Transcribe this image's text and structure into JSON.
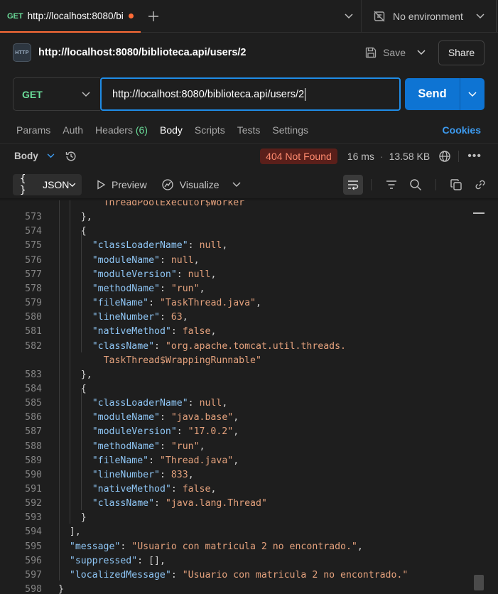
{
  "tab": {
    "method": "GET",
    "title": "http://localhost:8080/bi",
    "unsaved": true
  },
  "environment": {
    "label": "No environment"
  },
  "request": {
    "name": "http://localhost:8080/biblioteca.api/users/2",
    "save_label": "Save",
    "share_label": "Share",
    "method": "GET",
    "url": "http://localhost:8080/biblioteca.api/users/2",
    "send_label": "Send"
  },
  "request_tabs": {
    "params": "Params",
    "auth": "Auth",
    "headers": "Headers",
    "headers_count": "(6)",
    "body": "Body",
    "scripts": "Scripts",
    "tests": "Tests",
    "settings": "Settings",
    "cookies": "Cookies",
    "active": "Body"
  },
  "response": {
    "body_label": "Body",
    "status": "404 Not Found",
    "time": "16 ms",
    "size": "13.58 KB",
    "format": "JSON",
    "preview_label": "Preview",
    "visualize_label": "Visualize"
  },
  "code_lines": [
    {
      "n": "",
      "indent": 8,
      "parts": [
        [
          "s",
          "ThreadPoolExecutor$Worker"
        ]
      ]
    },
    {
      "n": "573",
      "indent": 4,
      "parts": [
        [
          "p",
          "},"
        ]
      ]
    },
    {
      "n": "574",
      "indent": 4,
      "parts": [
        [
          "p",
          "{"
        ]
      ]
    },
    {
      "n": "575",
      "indent": 6,
      "parts": [
        [
          "k",
          "\"classLoaderName\""
        ],
        [
          "p",
          ": "
        ],
        [
          "kw",
          "null"
        ],
        [
          "p",
          ","
        ]
      ]
    },
    {
      "n": "576",
      "indent": 6,
      "parts": [
        [
          "k",
          "\"moduleName\""
        ],
        [
          "p",
          ": "
        ],
        [
          "kw",
          "null"
        ],
        [
          "p",
          ","
        ]
      ]
    },
    {
      "n": "577",
      "indent": 6,
      "parts": [
        [
          "k",
          "\"moduleVersion\""
        ],
        [
          "p",
          ": "
        ],
        [
          "kw",
          "null"
        ],
        [
          "p",
          ","
        ]
      ]
    },
    {
      "n": "578",
      "indent": 6,
      "parts": [
        [
          "k",
          "\"methodName\""
        ],
        [
          "p",
          ": "
        ],
        [
          "s",
          "\"run\""
        ],
        [
          "p",
          ","
        ]
      ]
    },
    {
      "n": "579",
      "indent": 6,
      "parts": [
        [
          "k",
          "\"fileName\""
        ],
        [
          "p",
          ": "
        ],
        [
          "s",
          "\"TaskThread.java\""
        ],
        [
          "p",
          ","
        ]
      ]
    },
    {
      "n": "580",
      "indent": 6,
      "parts": [
        [
          "k",
          "\"lineNumber\""
        ],
        [
          "p",
          ": "
        ],
        [
          "n",
          "63"
        ],
        [
          "p",
          ","
        ]
      ]
    },
    {
      "n": "581",
      "indent": 6,
      "parts": [
        [
          "k",
          "\"nativeMethod\""
        ],
        [
          "p",
          ": "
        ],
        [
          "kw",
          "false"
        ],
        [
          "p",
          ","
        ]
      ]
    },
    {
      "n": "582",
      "indent": 6,
      "parts": [
        [
          "k",
          "\"className\""
        ],
        [
          "p",
          ": "
        ],
        [
          "s",
          "\"org.apache.tomcat.util.threads."
        ]
      ]
    },
    {
      "n": "",
      "indent": 8,
      "parts": [
        [
          "s",
          "TaskThread$WrappingRunnable\""
        ]
      ]
    },
    {
      "n": "583",
      "indent": 4,
      "parts": [
        [
          "p",
          "},"
        ]
      ]
    },
    {
      "n": "584",
      "indent": 4,
      "parts": [
        [
          "p",
          "{"
        ]
      ]
    },
    {
      "n": "585",
      "indent": 6,
      "parts": [
        [
          "k",
          "\"classLoaderName\""
        ],
        [
          "p",
          ": "
        ],
        [
          "kw",
          "null"
        ],
        [
          "p",
          ","
        ]
      ]
    },
    {
      "n": "586",
      "indent": 6,
      "parts": [
        [
          "k",
          "\"moduleName\""
        ],
        [
          "p",
          ": "
        ],
        [
          "s",
          "\"java.base\""
        ],
        [
          "p",
          ","
        ]
      ]
    },
    {
      "n": "587",
      "indent": 6,
      "parts": [
        [
          "k",
          "\"moduleVersion\""
        ],
        [
          "p",
          ": "
        ],
        [
          "s",
          "\"17.0.2\""
        ],
        [
          "p",
          ","
        ]
      ]
    },
    {
      "n": "588",
      "indent": 6,
      "parts": [
        [
          "k",
          "\"methodName\""
        ],
        [
          "p",
          ": "
        ],
        [
          "s",
          "\"run\""
        ],
        [
          "p",
          ","
        ]
      ]
    },
    {
      "n": "589",
      "indent": 6,
      "parts": [
        [
          "k",
          "\"fileName\""
        ],
        [
          "p",
          ": "
        ],
        [
          "s",
          "\"Thread.java\""
        ],
        [
          "p",
          ","
        ]
      ]
    },
    {
      "n": "590",
      "indent": 6,
      "parts": [
        [
          "k",
          "\"lineNumber\""
        ],
        [
          "p",
          ": "
        ],
        [
          "n",
          "833"
        ],
        [
          "p",
          ","
        ]
      ]
    },
    {
      "n": "591",
      "indent": 6,
      "parts": [
        [
          "k",
          "\"nativeMethod\""
        ],
        [
          "p",
          ": "
        ],
        [
          "kw",
          "false"
        ],
        [
          "p",
          ","
        ]
      ]
    },
    {
      "n": "592",
      "indent": 6,
      "parts": [
        [
          "k",
          "\"className\""
        ],
        [
          "p",
          ": "
        ],
        [
          "s",
          "\"java.lang.Thread\""
        ]
      ]
    },
    {
      "n": "593",
      "indent": 4,
      "parts": [
        [
          "p",
          "}"
        ]
      ]
    },
    {
      "n": "594",
      "indent": 2,
      "parts": [
        [
          "p",
          "],"
        ]
      ]
    },
    {
      "n": "595",
      "indent": 2,
      "parts": [
        [
          "k",
          "\"message\""
        ],
        [
          "p",
          ": "
        ],
        [
          "s",
          "\"Usuario con matricula 2 no encontrado.\""
        ],
        [
          "p",
          ","
        ]
      ]
    },
    {
      "n": "596",
      "indent": 2,
      "parts": [
        [
          "k",
          "\"suppressed\""
        ],
        [
          "p",
          ": []"
        ],
        [
          "p",
          ","
        ]
      ]
    },
    {
      "n": "597",
      "indent": 2,
      "parts": [
        [
          "k",
          "\"localizedMessage\""
        ],
        [
          "p",
          ": "
        ],
        [
          "s",
          "\"Usuario con matricula 2 no encontrado.\""
        ]
      ]
    },
    {
      "n": "598",
      "indent": 0,
      "parts": [
        [
          "p",
          "}"
        ]
      ]
    }
  ],
  "colors": {
    "accent": "#ff6c37",
    "method_get": "#6bdd9a",
    "send": "#0e74d3",
    "json_key": "#8fc6f5",
    "json_value": "#e5a27d",
    "status_404_bg": "#5a1f1a",
    "status_404_fg": "#ff8a6e"
  }
}
